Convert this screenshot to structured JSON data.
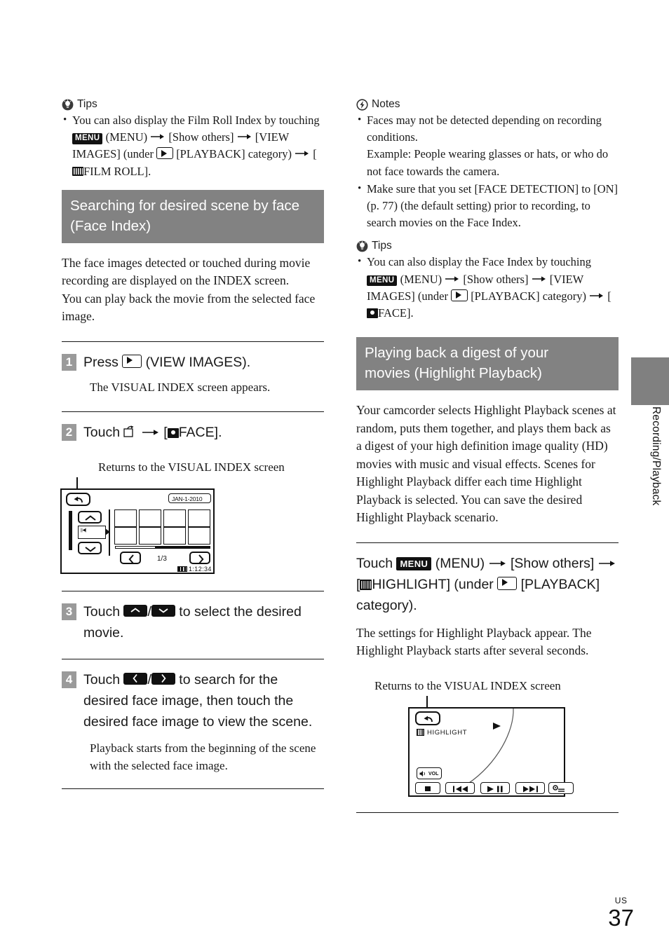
{
  "page": {
    "number": "37",
    "region_code": "US",
    "side_tab_label": "Recording/Playback"
  },
  "left_column": {
    "tips": {
      "icon": "lightbulb-icon",
      "heading": "Tips",
      "items": [
        {
          "parts": [
            {
              "t": "text",
              "v": "You can also display the Film Roll Index by touching "
            },
            {
              "t": "chip",
              "v": "MENU",
              "icon": "menu-chip"
            },
            {
              "t": "text",
              "v": " (MENU) "
            },
            {
              "t": "arrow",
              "v": "→"
            },
            {
              "t": "text",
              "v": " [Show others] "
            },
            {
              "t": "arrow",
              "v": "→"
            },
            {
              "t": "text",
              "v": " [VIEW IMAGES] (under "
            },
            {
              "t": "chip",
              "v": "",
              "icon": "playback-chip"
            },
            {
              "t": "text",
              "v": " [PLAYBACK] category) "
            },
            {
              "t": "arrow",
              "v": "→"
            },
            {
              "t": "text",
              "v": " ["
            },
            {
              "t": "chip",
              "v": "",
              "icon": "film-roll-chip"
            },
            {
              "t": "text",
              "v": "FILM ROLL]."
            }
          ]
        }
      ]
    },
    "section": {
      "heading_line1": "Searching for desired scene by face",
      "heading_line2": "(Face Index)",
      "intro": "The face images detected or touched during movie recording are displayed on the INDEX screen.\nYou can play back the movie from the selected face image."
    },
    "steps": [
      {
        "number": "1",
        "text_before": "Press ",
        "icon": "playback-chip",
        "text_after": " (VIEW IMAGES).",
        "sub": "The VISUAL INDEX screen appears."
      },
      {
        "number": "2",
        "text_before": "Touch ",
        "icon": "return-arrow-icon",
        "text_mid": " [",
        "icon2": "face-chip",
        "text_after": "FACE]."
      },
      {
        "number": "3",
        "text_before": "Touch ",
        "key_up": "up-key",
        "separator": "/",
        "key_down": "down-key",
        "text_after": " to select the desired movie."
      },
      {
        "number": "4",
        "text_before": "Touch ",
        "key_prev": "left-key",
        "separator": "/",
        "key_next": "right-key",
        "text_after": " to search for the desired face image, then touch the desired face image to view the scene.",
        "sub": "Playback starts from the beginning of the scene with the selected face image."
      }
    ],
    "figure": {
      "caption": "Returns to the VISUAL INDEX screen",
      "date_label": "JAN-1-2010",
      "page_indicator": "1/3",
      "time_code": "1:12:34",
      "return_button": "return-button",
      "up_button": "scroll-up-button",
      "down_button": "scroll-down-button",
      "prev_button": "previous-page-button",
      "next_button": "next-page-button"
    }
  },
  "right_column": {
    "notes": {
      "icon": "lightning-icon",
      "heading": "Notes",
      "items": [
        "Faces may not be detected depending on recording conditions.\nExample: People wearing glasses or hats, or who do not face towards the camera.",
        "Make sure that you set [FACE DETECTION] to [ON] (p. 77) (the default setting) prior to recording, to search movies on the Face Index."
      ]
    },
    "tips": {
      "icon": "lightbulb-icon",
      "heading": "Tips",
      "items": [
        {
          "parts": [
            {
              "t": "text",
              "v": "You can also display the Face Index by touching "
            },
            {
              "t": "chip",
              "v": "MENU",
              "icon": "menu-chip"
            },
            {
              "t": "text",
              "v": " (MENU) "
            },
            {
              "t": "arrow",
              "v": "→"
            },
            {
              "t": "text",
              "v": " [Show others] "
            },
            {
              "t": "arrow",
              "v": "→"
            },
            {
              "t": "text",
              "v": " [VIEW IMAGES] (under "
            },
            {
              "t": "chip",
              "v": "",
              "icon": "playback-chip"
            },
            {
              "t": "text",
              "v": " [PLAYBACK] category) "
            },
            {
              "t": "arrow",
              "v": "→"
            },
            {
              "t": "text",
              "v": " ["
            },
            {
              "t": "chip",
              "v": "",
              "icon": "face-chip"
            },
            {
              "t": "text",
              "v": "FACE]."
            }
          ]
        }
      ]
    },
    "section": {
      "heading_line1": "Playing back a digest of your",
      "heading_line2": "movies (Highlight Playback)",
      "body": "Your camcorder selects Highlight Playback scenes at random, puts them together, and plays them back as a digest of your high definition image quality (HD) movies with music and visual effects. Scenes for Highlight Playback differ each time Highlight Playback is selected. You can save the desired Highlight Playback scenario."
    },
    "instruction": {
      "t1": "Touch ",
      "menu_chip": "MENU",
      "t2": " (MENU) ",
      "t3": " [Show others] ",
      "t4": " [",
      "highlight_chip": "highlight-chip",
      "t5": "HIGHLIGHT] (under ",
      "playback_chip": "playback-chip",
      "t6": " [PLAYBACK] category).",
      "sub": "The settings for Highlight Playback appear. The Highlight Playback starts after several seconds."
    },
    "figure": {
      "caption": "Returns to the VISUAL INDEX screen",
      "highlight_label": "HIGHLIGHT",
      "volume_label": "VOL",
      "return_button": "return-button",
      "stop_button": "stop-button",
      "prev_button": "previous-button",
      "play_pause_button": "play-pause-button",
      "next_button": "next-button",
      "options_button": "options-button"
    }
  }
}
